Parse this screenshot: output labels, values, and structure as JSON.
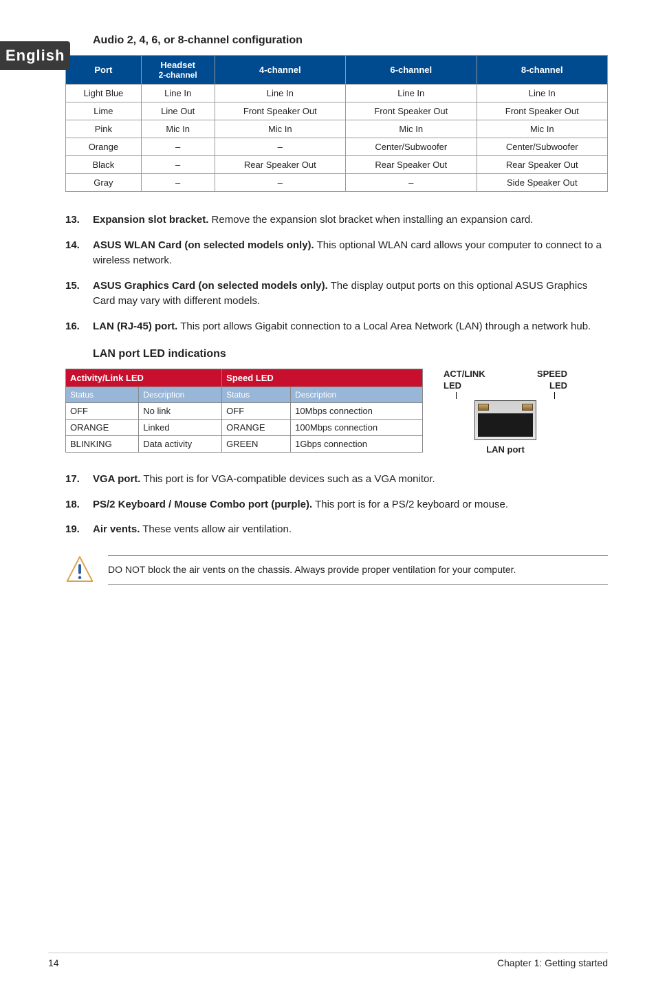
{
  "side_tab": "English",
  "audio_heading": "Audio 2, 4, 6, or 8-channel configuration",
  "audio_table": {
    "headers": {
      "port": "Port",
      "headset_line1": "Headset",
      "headset_line2": "2-channel",
      "ch4": "4-channel",
      "ch6": "6-channel",
      "ch8": "8-channel"
    },
    "rows": [
      {
        "port": "Light Blue",
        "c2": "Line In",
        "c4": "Line In",
        "c6": "Line In",
        "c8": "Line In"
      },
      {
        "port": "Lime",
        "c2": "Line Out",
        "c4": "Front Speaker Out",
        "c6": "Front Speaker Out",
        "c8": "Front Speaker Out"
      },
      {
        "port": "Pink",
        "c2": "Mic In",
        "c4": "Mic In",
        "c6": "Mic In",
        "c8": "Mic In"
      },
      {
        "port": "Orange",
        "c2": "–",
        "c4": "–",
        "c6": "Center/Subwoofer",
        "c8": "Center/Subwoofer"
      },
      {
        "port": "Black",
        "c2": "–",
        "c4": "Rear Speaker Out",
        "c6": "Rear Speaker Out",
        "c8": "Rear Speaker Out"
      },
      {
        "port": "Gray",
        "c2": "–",
        "c4": "–",
        "c6": "–",
        "c8": "Side Speaker Out"
      }
    ]
  },
  "items_a": [
    {
      "num": "13.",
      "bold": "Expansion slot bracket.",
      "text": " Remove the expansion slot bracket when installing an expansion card."
    },
    {
      "num": "14.",
      "bold": "ASUS WLAN Card (on selected models only).",
      "text": " This optional WLAN card allows your computer to connect to a wireless network."
    },
    {
      "num": "15.",
      "bold": "ASUS Graphics Card (on selected models only).",
      "text": " The display output ports on this optional ASUS Graphics Card may vary with different models."
    },
    {
      "num": "16.",
      "bold": "LAN (RJ-45) port.",
      "text": " This port allows Gigabit connection to a Local Area Network (LAN) through a network hub."
    }
  ],
  "lan_heading": "LAN port LED indications",
  "lan_table": {
    "group_activity": "Activity/Link LED",
    "group_speed": "Speed LED",
    "sub_status": "Status",
    "sub_desc": "Description",
    "rows": [
      {
        "as": "OFF",
        "ad": "No link",
        "ss": "OFF",
        "sd": "10Mbps connection"
      },
      {
        "as": "ORANGE",
        "ad": "Linked",
        "ss": "ORANGE",
        "sd": "100Mbps connection"
      },
      {
        "as": "BLINKING",
        "ad": "Data activity",
        "ss": "GREEN",
        "sd": "1Gbps connection"
      }
    ]
  },
  "lan_figure": {
    "top1": "ACT/LINK",
    "top2": "SPEED",
    "led1": "LED",
    "led2": "LED",
    "caption": "LAN port"
  },
  "items_b": [
    {
      "num": "17.",
      "bold": "VGA port.",
      "text": " This port is for VGA-compatible devices such as a VGA monitor."
    },
    {
      "num": "18.",
      "bold": "PS/2 Keyboard / Mouse Combo port (purple).",
      "text": " This port is for a PS/2 keyboard or mouse."
    },
    {
      "num": "19.",
      "bold": "Air vents.",
      "text": " These vents allow air ventilation."
    }
  ],
  "note": "DO NOT block the air vents on the chassis. Always provide proper ventilation for your computer.",
  "footer": {
    "left": "14",
    "right": "Chapter 1: Getting started"
  }
}
